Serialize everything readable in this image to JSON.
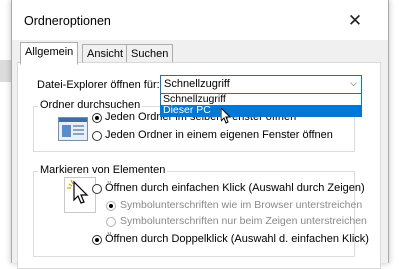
{
  "window": {
    "title": "Ordneroptionen"
  },
  "tabs": [
    {
      "label": "Allgemein",
      "active": true
    },
    {
      "label": "Ansicht",
      "active": false
    },
    {
      "label": "Suchen",
      "active": false
    }
  ],
  "explorer_open": {
    "label": "Datei-Explorer öffnen für:",
    "selected": "Schnellzugriff",
    "options": [
      {
        "label": "Schnellzugriff",
        "highlighted": false
      },
      {
        "label": "Dieser PC",
        "highlighted": true
      }
    ]
  },
  "browse_folders": {
    "title": "Ordner durchsuchen",
    "options": [
      {
        "label": "Jeden Ordner im selben Fenster öffnen",
        "checked": true
      },
      {
        "label": "Jeden Ordner in einem eigenen Fenster öffnen",
        "checked": false
      }
    ]
  },
  "mark_items": {
    "title": "Markieren von Elementen",
    "options": [
      {
        "label": "Öffnen durch einfachen Klick (Auswahl durch Zeigen)",
        "checked": false,
        "disabled": false
      },
      {
        "label": "Symbolunterschriften wie im Browser unterstreichen",
        "checked": true,
        "disabled": true
      },
      {
        "label": "Symbolunterschriften nur beim Zeigen unterstreichen",
        "checked": false,
        "disabled": true
      },
      {
        "label": "Öffnen durch Doppelklick (Auswahl d. einfachen Klick)",
        "checked": true,
        "disabled": false
      }
    ]
  },
  "colors": {
    "accent": "#0078d7",
    "dialog_bg": "#f0f0f0"
  },
  "icons": {
    "close": "close-icon",
    "dropdown": "chevron-down-icon",
    "cursor": "mouse-cursor-icon"
  }
}
